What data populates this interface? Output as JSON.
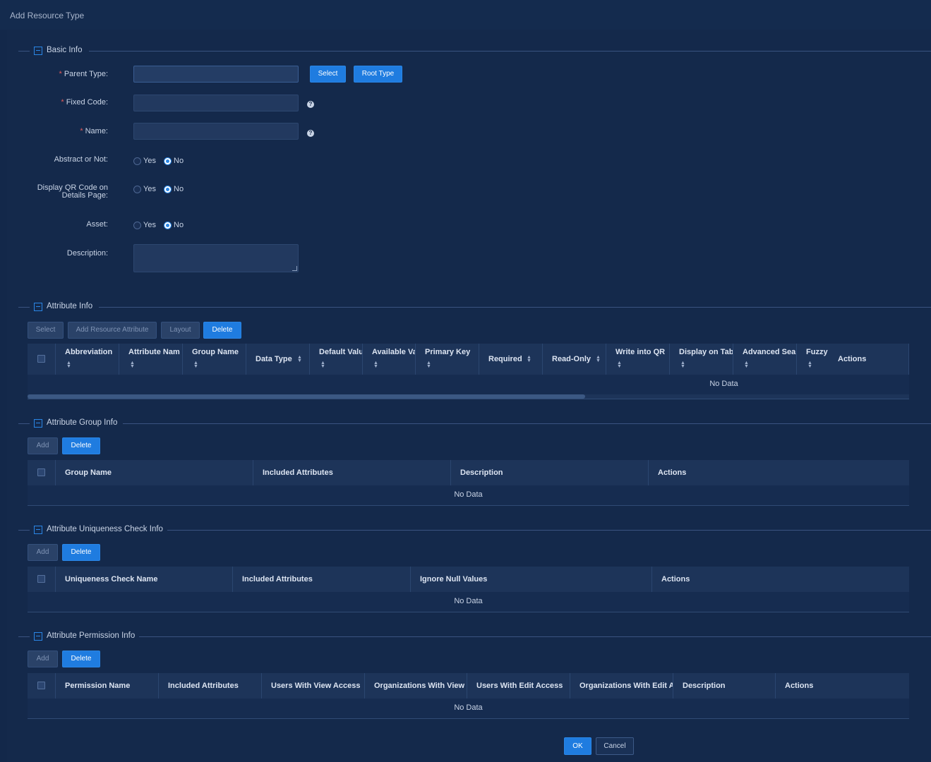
{
  "window": {
    "title": "Add Resource Type"
  },
  "sections": {
    "basic": "Basic Info",
    "attribute": "Attribute Info",
    "group": "Attribute Group Info",
    "uniqueness": "Attribute Uniqueness Check Info",
    "permission": "Attribute Permission Info"
  },
  "form": {
    "required_mark": "*",
    "parent_type": "Parent Type:",
    "fixed_code": "Fixed Code:",
    "name": "Name:",
    "abstract": "Abstract or Not:",
    "display_qr_line1": "Display QR Code on",
    "display_qr_line2": "Details Page:",
    "asset": "Asset:",
    "description": "Description:",
    "yes": "Yes",
    "no": "No",
    "help_glyph": "?",
    "select_button": "Select",
    "root_type_button": "Root Type"
  },
  "attribute_toolbar": {
    "select": "Select",
    "add_resource_attribute": "Add Resource Attribute",
    "layout": "Layout",
    "delete": "Delete"
  },
  "attribute_table": {
    "columns": [
      "Abbreviation",
      "Attribute Nam",
      "Group Name",
      "Data Type",
      "Default Valu",
      "Available Va",
      "Primary Key",
      "Required",
      "Read-Only",
      "Write into QR",
      "Display on Tab",
      "Advanced Sear",
      "Fuzzy S",
      "Actions"
    ],
    "empty": "No Data"
  },
  "group_toolbar": {
    "add": "Add",
    "delete": "Delete"
  },
  "group_table": {
    "columns": [
      "Group Name",
      "Included Attributes",
      "Description",
      "Actions"
    ],
    "empty": "No Data"
  },
  "uniqueness_toolbar": {
    "add": "Add",
    "delete": "Delete"
  },
  "uniqueness_table": {
    "columns": [
      "Uniqueness Check Name",
      "Included Attributes",
      "Ignore Null Values",
      "Actions"
    ],
    "empty": "No Data"
  },
  "permission_toolbar": {
    "add": "Add",
    "delete": "Delete"
  },
  "permission_table": {
    "columns": [
      "Permission Name",
      "Included Attributes",
      "Users With View Access",
      "Organizations With View",
      "Users With Edit Access",
      "Organizations With Edit A",
      "Description",
      "Actions"
    ],
    "empty": "No Data"
  },
  "footer": {
    "ok": "OK",
    "cancel": "Cancel"
  },
  "colors": {
    "accent": "#1f7ce0",
    "background": "#13284a",
    "required": "#e05a5a"
  }
}
